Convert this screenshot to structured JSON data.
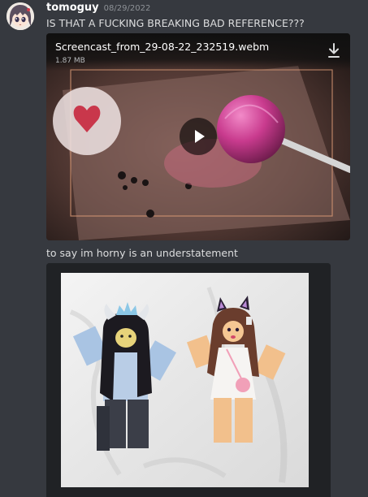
{
  "message": {
    "username": "tomoguy",
    "timestamp": "08/29/2022",
    "text_1": "IS THAT A FUCKING BREAKING BAD REFERENCE???",
    "text_2": "to say im horny is an understatement"
  },
  "video": {
    "filename": "Screencast_from_29-08-22_232519.webm",
    "size": "1.87 MB"
  },
  "colors": {
    "background": "#36393f",
    "username": "#ffffff",
    "text": "#dcddde",
    "timestamp": "#8e9297"
  },
  "icons": [
    "avatar",
    "download-icon",
    "play-icon"
  ]
}
